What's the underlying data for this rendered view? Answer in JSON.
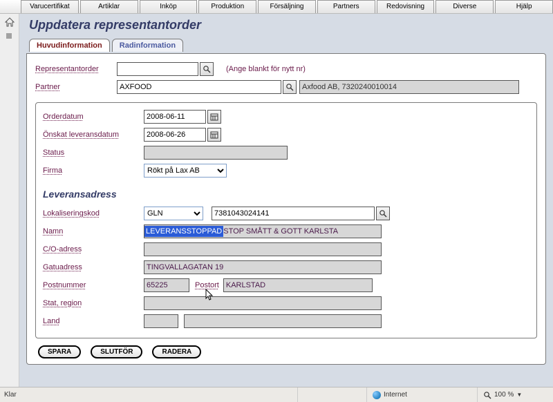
{
  "menu": [
    "Varucertifikat",
    "Artiklar",
    "Inköp",
    "Produktion",
    "Försäljning",
    "Partners",
    "Redovisning",
    "Diverse",
    "Hjälp"
  ],
  "page": {
    "title": "Uppdatera representantorder"
  },
  "tabs": {
    "main": "Huvudinformation",
    "lines": "Radinformation"
  },
  "head": {
    "reporder_label": "Representantorder",
    "reporder_value": "",
    "reporder_hint": "(Ange blankt för nytt nr)",
    "partner_label": "Partner",
    "partner_value": "AXFOOD",
    "partner_display": "Axfood AB, 7320240010014"
  },
  "order": {
    "orderdate_label": "Orderdatum",
    "orderdate_value": "2008-06-11",
    "reqdate_label": "Önskat leveransdatum",
    "reqdate_value": "2008-06-26",
    "status_label": "Status",
    "status_value": "",
    "firma_label": "Firma",
    "firma_value": "Rökt på Lax AB"
  },
  "delivery": {
    "heading": "Leveransadress",
    "loccode_label": "Lokaliseringskod",
    "loccode_type": "GLN",
    "loccode_value": "7381043024141",
    "name_label": "Namn",
    "name_highlight": "LEVERANSSTOPPAD",
    "name_rest": " STOP SMÅTT & GOTT KARLSTA",
    "co_label": "C/O-adress",
    "co_value": "",
    "street_label": "Gatuadress",
    "street_value": "TINGVALLAGATAN 19",
    "postnr_label": "Postnummer",
    "postnr_value": "65225",
    "postort_label": "Postort",
    "postort_value": "KARLSTAD",
    "state_label": "Stat, region",
    "state_value": "",
    "country_label": "Land",
    "country_code": "",
    "country_name": ""
  },
  "buttons": {
    "save": "SPARA",
    "finish": "SLUTFÖR",
    "delete": "RADERA"
  },
  "status": {
    "left": "Klar",
    "zone": "Internet",
    "zoom": "100 %"
  }
}
